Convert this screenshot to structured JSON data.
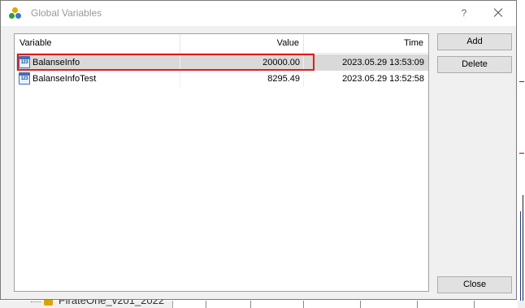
{
  "dialog": {
    "title": "Global Variables",
    "help_label": "?",
    "close_icon": "close-icon"
  },
  "table": {
    "columns": [
      "Variable",
      "Value",
      "Time"
    ],
    "rows": [
      {
        "variable": "BalanseInfo",
        "value": "20000.00",
        "time": "2023.05.29 13:53:09",
        "selected": true
      },
      {
        "variable": "BalanseInfoTest",
        "value": "8295.49",
        "time": "2023.05.29 13:52:58",
        "selected": false
      }
    ],
    "row_icon_text": "123"
  },
  "buttons": {
    "add": "Add",
    "delete": "Delete",
    "close": "Close"
  },
  "background": {
    "tree_item": "PirateOne_v201_2022"
  },
  "colors": {
    "highlight": "#e31b1b",
    "selected_row": "#d9d9d9"
  }
}
